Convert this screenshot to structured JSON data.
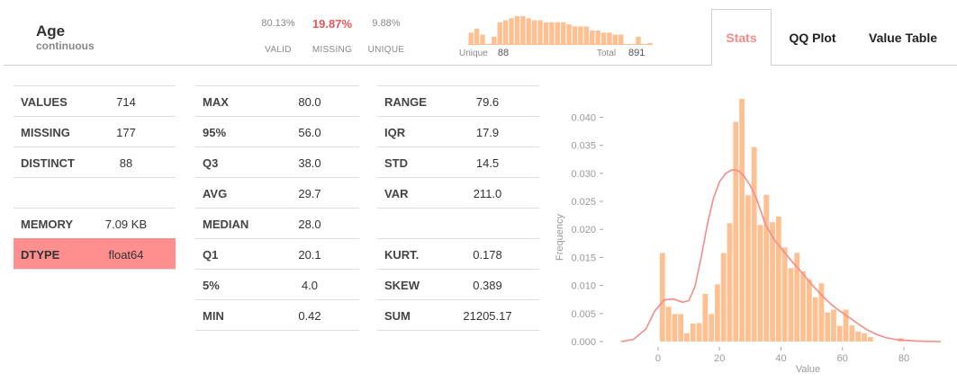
{
  "column": {
    "name": "Age",
    "kind": "continuous"
  },
  "summary": {
    "valid_pct": "80.13%",
    "missing_pct": "19.87%",
    "unique_pct": "9.88%",
    "valid_label": "VALID",
    "missing_label": "MISSING",
    "unique_label": "UNIQUE",
    "unique_label2": "Unique",
    "unique_count": "88",
    "total_label": "Total",
    "total_count": "891"
  },
  "mini_hist": [
    6,
    8,
    5,
    0,
    4,
    11,
    12,
    13,
    14,
    14,
    13,
    12,
    12,
    11,
    11,
    11,
    11,
    10,
    9,
    9,
    9,
    7,
    7,
    6,
    6,
    5,
    5,
    0,
    0,
    4,
    0,
    1
  ],
  "tabs": [
    {
      "label": "Stats",
      "active": true
    },
    {
      "label": "QQ Plot",
      "active": false
    },
    {
      "label": "Value Table",
      "active": false
    }
  ],
  "table1": [
    {
      "k": "VALUES",
      "v": "714"
    },
    {
      "k": "MISSING",
      "v": "177"
    },
    {
      "k": "DISTINCT",
      "v": "88"
    },
    {
      "k": "",
      "v": ""
    },
    {
      "k": "MEMORY",
      "v": "7.09 KB"
    },
    {
      "k": "DTYPE",
      "v": "float64"
    }
  ],
  "table2": [
    {
      "k": "MAX",
      "v": "80.0"
    },
    {
      "k": "95%",
      "v": "56.0"
    },
    {
      "k": "Q3",
      "v": "38.0"
    },
    {
      "k": "AVG",
      "v": "29.7"
    },
    {
      "k": "MEDIAN",
      "v": "28.0"
    },
    {
      "k": "Q1",
      "v": "20.1"
    },
    {
      "k": "5%",
      "v": "4.0"
    },
    {
      "k": "MIN",
      "v": "0.42"
    }
  ],
  "table3": [
    {
      "k": "RANGE",
      "v": "79.6"
    },
    {
      "k": "IQR",
      "v": "17.9"
    },
    {
      "k": "STD",
      "v": "14.5"
    },
    {
      "k": "VAR",
      "v": "211.0"
    },
    {
      "k": "",
      "v": ""
    },
    {
      "k": "KURT.",
      "v": "0.178"
    },
    {
      "k": "SKEW",
      "v": "0.389"
    },
    {
      "k": "SUM",
      "v": "21205.17"
    }
  ],
  "colors": {
    "accent": "#f58b87",
    "bar": "#ffc091",
    "kde": "#f58b87",
    "highlight": "#ff8e8e"
  },
  "chart_data": {
    "type": "bar",
    "xlabel": "Value",
    "ylabel": "Frequency",
    "xlim": [
      -12,
      92
    ],
    "ylim": [
      0,
      0.042
    ],
    "xticks": [
      0,
      20,
      40,
      60,
      80
    ],
    "yticks": [
      0.0,
      0.005,
      0.01,
      0.015,
      0.02,
      0.025,
      0.03,
      0.035,
      0.04
    ],
    "ytick_labels": [
      "0.000",
      "0.005",
      "0.010",
      "0.015",
      "0.020",
      "0.025",
      "0.030",
      "0.035",
      "0.040"
    ],
    "bin_start": 0.42,
    "bin_width": 1.99,
    "bins": [
      0.0158,
      0.0062,
      0.0049,
      0.0049,
      0.0015,
      0.0032,
      0.0033,
      0.0085,
      0.0049,
      0.0102,
      0.0158,
      0.0211,
      0.0392,
      0.0433,
      0.0261,
      0.0347,
      0.0208,
      0.0262,
      0.0213,
      0.0223,
      0.0168,
      0.0131,
      0.0158,
      0.0125,
      0.0111,
      0.0079,
      0.0104,
      0.0052,
      0.0057,
      0.0028,
      0.0057,
      0.0029,
      0.0018,
      0.0015,
      0.0008,
      0.0,
      0.0,
      0.0,
      0.0,
      0.0006
    ],
    "kde": [
      [
        -12,
        0.0
      ],
      [
        -8,
        0.0004
      ],
      [
        -4,
        0.0022
      ],
      [
        -1,
        0.0055
      ],
      [
        2,
        0.0074
      ],
      [
        5,
        0.0076
      ],
      [
        8,
        0.007
      ],
      [
        10,
        0.0073
      ],
      [
        12,
        0.0098
      ],
      [
        14,
        0.015
      ],
      [
        16,
        0.0208
      ],
      [
        18,
        0.0255
      ],
      [
        20,
        0.0285
      ],
      [
        22,
        0.03
      ],
      [
        24,
        0.0306
      ],
      [
        26,
        0.0305
      ],
      [
        28,
        0.0295
      ],
      [
        30,
        0.0278
      ],
      [
        32,
        0.0255
      ],
      [
        35,
        0.0208
      ],
      [
        38,
        0.018
      ],
      [
        41,
        0.016
      ],
      [
        44,
        0.014
      ],
      [
        47,
        0.0122
      ],
      [
        50,
        0.0102
      ],
      [
        53,
        0.0084
      ],
      [
        56,
        0.0068
      ],
      [
        59,
        0.0055
      ],
      [
        62,
        0.0044
      ],
      [
        65,
        0.0032
      ],
      [
        68,
        0.0021
      ],
      [
        71,
        0.0013
      ],
      [
        74,
        0.0007
      ],
      [
        78,
        0.0003
      ],
      [
        84,
        0.0001
      ],
      [
        92,
        0.0
      ]
    ]
  }
}
